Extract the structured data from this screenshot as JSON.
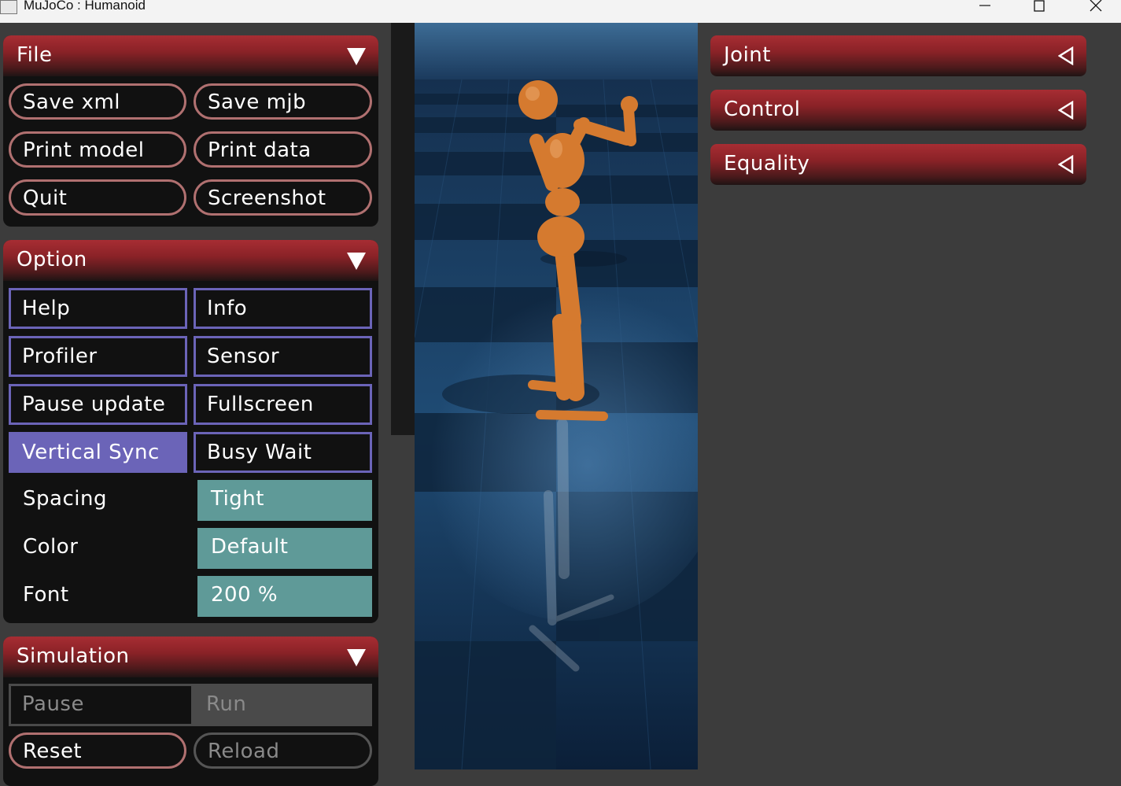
{
  "window": {
    "title": "MuJoCo : Humanoid"
  },
  "file": {
    "title": "File",
    "buttons": [
      "Save xml",
      "Save mjb",
      "Print model",
      "Print data",
      "Quit",
      "Screenshot"
    ]
  },
  "option": {
    "title": "Option",
    "toggles": [
      {
        "label": "Help",
        "on": false
      },
      {
        "label": "Info",
        "on": false
      },
      {
        "label": "Profiler",
        "on": false
      },
      {
        "label": "Sensor",
        "on": false
      },
      {
        "label": "Pause update",
        "on": false
      },
      {
        "label": "Fullscreen",
        "on": false
      },
      {
        "label": "Vertical Sync",
        "on": true
      },
      {
        "label": "Busy Wait",
        "on": false
      }
    ],
    "selects": [
      {
        "label": "Spacing",
        "value": "Tight"
      },
      {
        "label": "Color",
        "value": "Default"
      },
      {
        "label": "Font",
        "value": "200 %"
      }
    ]
  },
  "simulation": {
    "title": "Simulation",
    "radio": [
      "Pause",
      "Run"
    ],
    "selected": "Run",
    "buttons": [
      "Reset",
      "Reload"
    ]
  },
  "right_sections": [
    "Joint",
    "Control",
    "Equality"
  ],
  "colors": {
    "header_red": "#a72d33",
    "toggle_border": "#6b64b8",
    "select_teal": "#5f9a98",
    "button_border": "#b07070"
  }
}
